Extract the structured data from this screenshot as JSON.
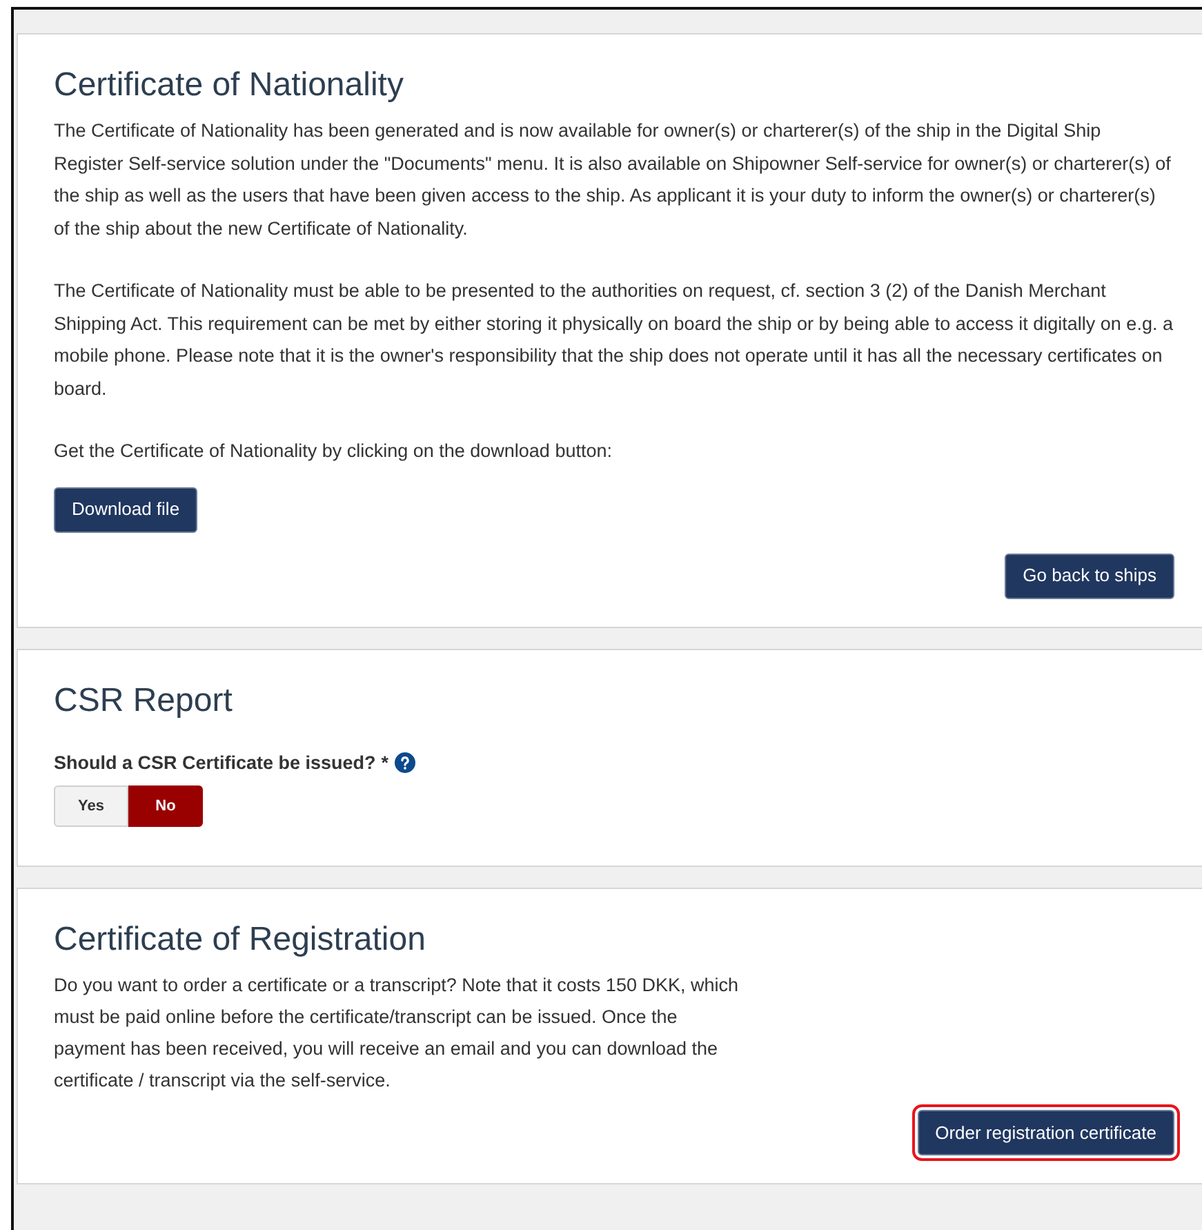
{
  "sections": [
    {
      "kind": "nationality",
      "title": "Certificate of Nationality",
      "paragraphs": [
        "The Certificate of Nationality has been generated and is now available for owner(s) or charterer(s) of the ship in the Digital Ship Register Self-service solution under the \"Documents\" menu. It is also available on Shipowner Self-service for owner(s) or charterer(s) of the ship as well as the users that have been given access to the ship. As applicant it is your duty to inform the owner(s) or charterer(s) of the ship about the new Certificate of Nationality.",
        "The Certificate of Nationality must be able to be presented to the authorities on request, cf. section 3 (2) of the Danish Merchant Shipping Act. This requirement can be met by either storing it physically on board the ship or by being able to access it digitally on e.g. a mobile phone. Please note that it is the owner's responsibility that the ship does not operate until it has all the necessary certificates on board.",
        "Get the Certificate of Nationality by clicking on the download button:"
      ],
      "left_button": {
        "label": "Download file"
      },
      "right_button": {
        "label": "Go back to ships"
      }
    },
    {
      "kind": "csr",
      "title": "CSR Report",
      "question": "Should a CSR Certificate be issued?",
      "required_mark": "*",
      "options": [
        {
          "label": "Yes",
          "selected": false
        },
        {
          "label": "No",
          "selected": true
        }
      ]
    },
    {
      "kind": "registration",
      "title": "Certificate of Registration",
      "paragraphs": [
        "Do you want to order a certificate or a transcript? Note that it costs 150 DKK, which must be paid online before the certificate/transcript can be issued. Once the payment has been received, you will receive an email and you can download the certificate / transcript via the self-service."
      ],
      "right_button": {
        "label": "Order registration certificate",
        "highlighted": true
      }
    }
  ]
}
